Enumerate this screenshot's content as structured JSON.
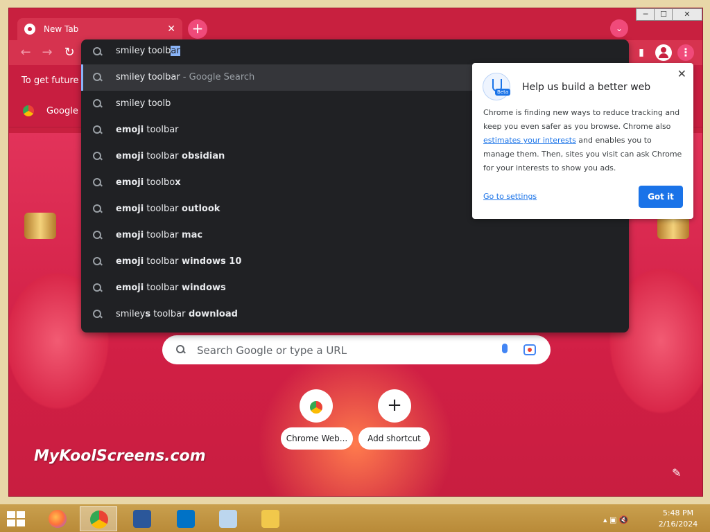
{
  "browser": {
    "tab_title": "New Tab",
    "tab_close": "✕",
    "new_tab": "+",
    "window_buttons": {
      "minimize": "─",
      "maximize": "☐",
      "close": "✕"
    }
  },
  "toolbar": {
    "back": "←",
    "forward": "→",
    "reload": "↻",
    "side_panel": "▮",
    "menu": "⋮"
  },
  "omnibox": {
    "typed": "smiley toolb",
    "autocomplete_selected": "ar"
  },
  "suggestions": [
    {
      "normal": "smiley toolbar",
      "bold": "",
      "sub": " - Google Search"
    },
    {
      "normal": "smiley toolb",
      "bold": "",
      "sub": ""
    },
    {
      "pre_bold": "emoji",
      "normal": " toolbar",
      "bold": "",
      "sub": ""
    },
    {
      "pre_bold": "emoji",
      "normal": " toolbar",
      "bold": " obsidian",
      "sub": ""
    },
    {
      "pre_bold": "emoji",
      "normal": " toolbo",
      "bold": "x",
      "sub": ""
    },
    {
      "pre_bold": "emoji",
      "normal": " toolbar",
      "bold": " outlook",
      "sub": ""
    },
    {
      "pre_bold": "emoji",
      "normal": " toolbar",
      "bold": " mac",
      "sub": ""
    },
    {
      "pre_bold": "emoji",
      "normal": " toolbar",
      "bold": " windows 10",
      "sub": ""
    },
    {
      "pre_bold": "emoji",
      "normal": " toolbar",
      "bold": " windows",
      "sub": ""
    },
    {
      "normal": "smiley",
      "mid_bold": "s",
      "normal2": " toolbar",
      "bold": " download",
      "sub": ""
    }
  ],
  "infobar": {
    "text": "To get future G"
  },
  "bookmarks": {
    "item": "Google C"
  },
  "popup": {
    "title": "Help us build a better web",
    "beta_tag": "Beta",
    "body_1": "Chrome is finding new ways to reduce tracking and keep you even safer as you browse. Chrome also ",
    "body_link": "estimates your interests",
    "body_2": " and enables you to manage them. Then, sites you visit can ask Chrome for your interests to show you ads.",
    "settings_link": "Go to settings",
    "button": "Got it",
    "close": "✕"
  },
  "ntp": {
    "search_placeholder": "Search Google or type a URL",
    "shortcuts": [
      {
        "label": "Chrome Web..."
      },
      {
        "label": "Add shortcut",
        "icon": "+"
      }
    ],
    "watermark": "MyKoolScreens.com",
    "customize": "✎"
  },
  "taskbar": {
    "apps": [
      "firefox-icon",
      "chrome-icon",
      "word-icon",
      "outlook-icon",
      "photo-viewer-icon",
      "file-explorer-icon"
    ],
    "tray": "▴",
    "time": "5:48 PM",
    "date": "2/16/2024"
  },
  "colors": {
    "accent": "#1a73e8",
    "theme_red": "#c8203f",
    "dropdown_bg": "#202124"
  }
}
